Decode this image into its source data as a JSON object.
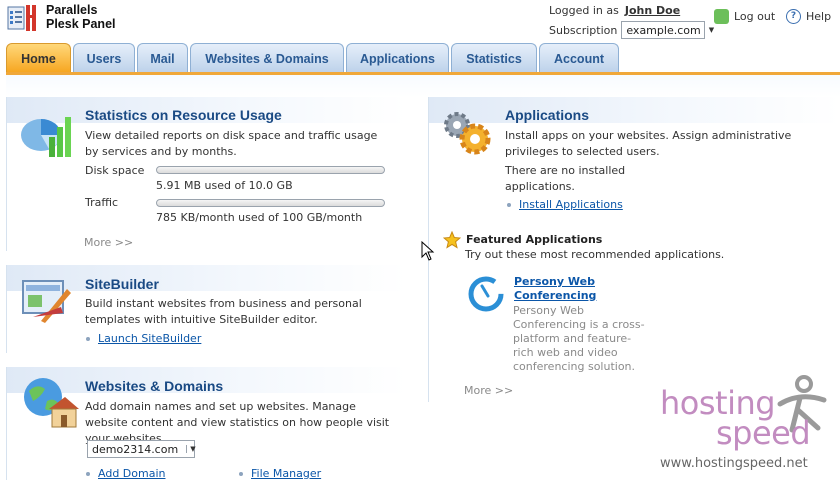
{
  "app": {
    "name_line1": "Parallels",
    "name_line2": "Plesk Panel"
  },
  "user": {
    "logged_in_label": "Logged in as",
    "name": "John Doe",
    "subscription_label": "Subscription",
    "subscription_value": "example.com",
    "logout_label": "Log out",
    "help_label": "Help"
  },
  "tabs": [
    {
      "label": "Home",
      "active": true
    },
    {
      "label": "Users",
      "active": false
    },
    {
      "label": "Mail",
      "active": false
    },
    {
      "label": "Websites & Domains",
      "active": false
    },
    {
      "label": "Applications",
      "active": false
    },
    {
      "label": "Statistics",
      "active": false
    },
    {
      "label": "Account",
      "active": false
    }
  ],
  "stats": {
    "title": "Statistics on Resource Usage",
    "description": "View detailed reports on disk space and traffic usage by services and by months.",
    "disk_label": "Disk space",
    "disk_value": "5.91 MB used of 10.0 GB",
    "disk_fraction": 0.0006,
    "traffic_label": "Traffic",
    "traffic_value": "785 KB/month used of 100 GB/month",
    "traffic_fraction": 7.7e-06,
    "more": "More >>"
  },
  "sitebuilder": {
    "title": "SiteBuilder",
    "description": "Build instant websites from business and personal templates with intuitive SiteBuilder editor.",
    "link": "Launch SiteBuilder"
  },
  "websites": {
    "title": "Websites & Domains",
    "description": "Add domain names and set up websites. Manage website content and view statistics on how people visit your websites.",
    "domain_select": "demo2314.com",
    "link_add_domain": "Add Domain",
    "link_file_manager": "File Manager"
  },
  "applications": {
    "title": "Applications",
    "description": "Install apps on your websites. Assign administrative privileges to selected users.",
    "no_apps": "There are no installed applications.",
    "install_link": "Install Applications",
    "featured_title": "Featured Applications",
    "featured_desc": "Try out these most recommended applications.",
    "app_name": "Persony Web Conferencing",
    "app_desc": "Persony Web Conferencing is a cross-platform and feature-rich web and video conferencing solution.",
    "more": "More >>"
  },
  "watermark": {
    "line1": "hosting",
    "line2": "speed",
    "url": "www.hostingspeed.net"
  },
  "colors": {
    "accent": "#f6a51f",
    "tab_text": "#2a5a93",
    "title": "#1a4a84",
    "link": "#0b56a8",
    "watermark": "#c28cc0"
  }
}
